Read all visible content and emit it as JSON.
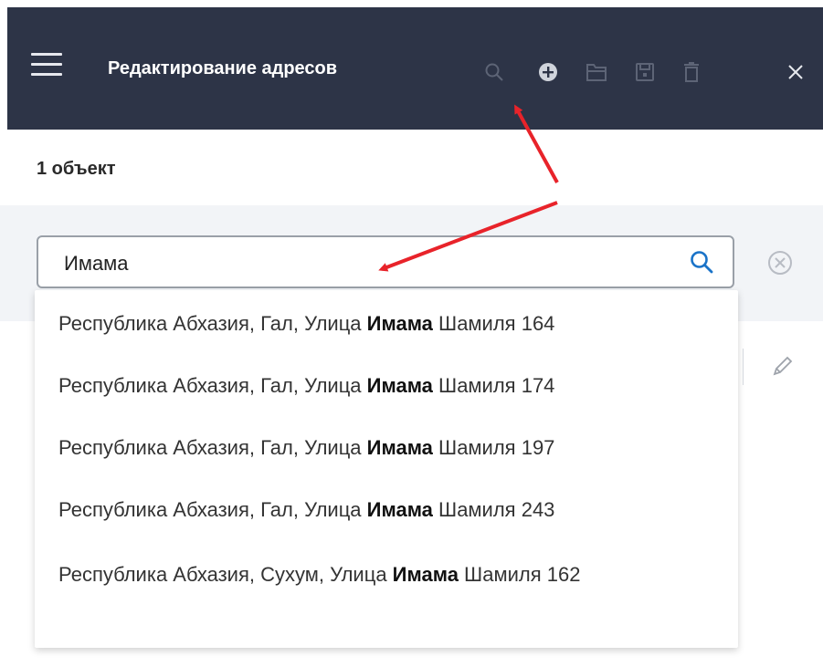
{
  "header": {
    "title": "Редактирование адресов",
    "background": "#2d3447",
    "icons": [
      "menu-icon",
      "search-icon",
      "add-circle-icon",
      "folder-icon",
      "save-icon",
      "trash-icon",
      "close-icon"
    ]
  },
  "list": {
    "count_label": "1 объект"
  },
  "search": {
    "value": "Имама",
    "accent": "#1a73c8"
  },
  "suggestions": [
    {
      "before": "Республика Абхазия, Гал, Улица ",
      "match": "Имама",
      "after": " Шамиля 164"
    },
    {
      "before": "Республика Абхазия, Гал, Улица ",
      "match": "Имама",
      "after": " Шамиля 174"
    },
    {
      "before": "Республика Абхазия, Гал, Улица ",
      "match": "Имама",
      "after": " Шамиля 197"
    },
    {
      "before": "Республика Абхазия, Гал, Улица ",
      "match": "Имама",
      "after": " Шамиля 243"
    },
    {
      "before": "Республика Абхазия, Сухум, Улица ",
      "match": "Имама",
      "after": " Шамиля 162"
    }
  ],
  "annotation_color": "#e8232a"
}
